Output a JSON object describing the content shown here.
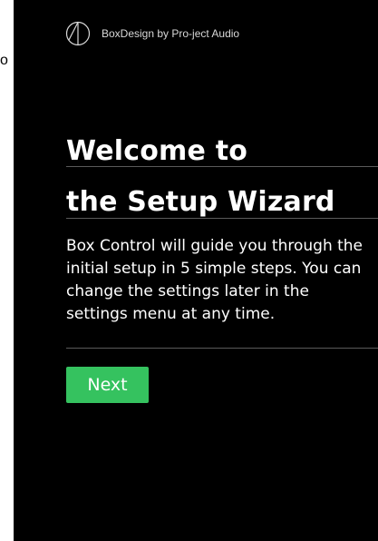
{
  "stray_text": "o",
  "brand": {
    "logo_icon": "project-audio-logo-icon",
    "name": "BoxDesign by Pro-ject Audio"
  },
  "wizard": {
    "title_line1": "Welcome to",
    "title_line2": "the Setup Wizard",
    "description_lines": [
      "Box Control will guide you through the",
      "initial setup in 5 simple steps. You can",
      "change the settings later in the",
      "settings menu at any time."
    ],
    "next_label": "Next"
  },
  "colors": {
    "panel_background": "#000000",
    "text": "#ffffff",
    "brand_text": "#d8d8d8",
    "button": "#35c25f",
    "divider": "#5a5a5a"
  }
}
